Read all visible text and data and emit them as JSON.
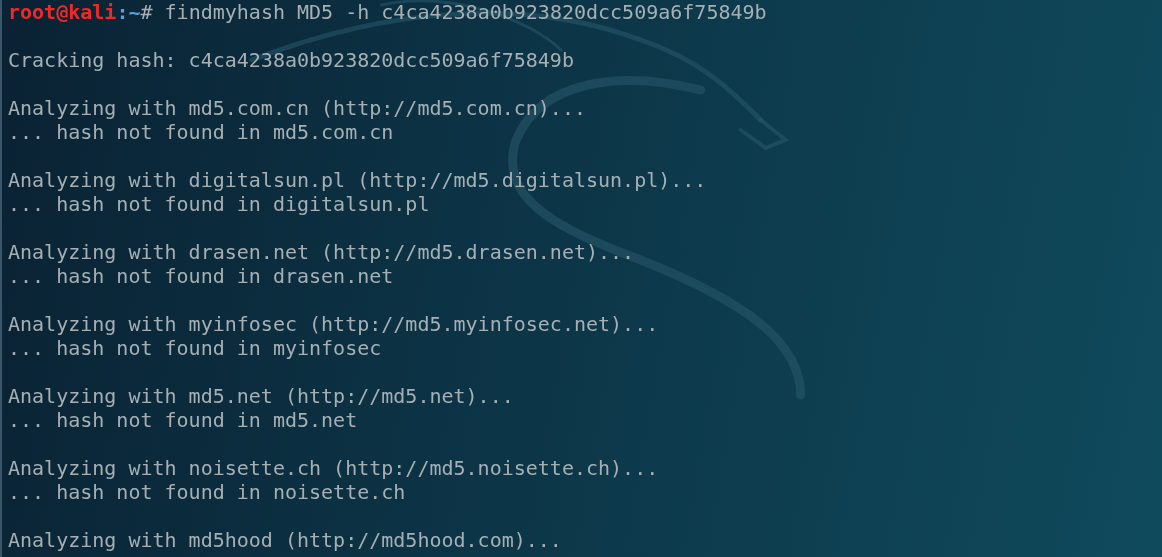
{
  "prompt": {
    "user_host": "root@kali",
    "path": ":~",
    "symbol": "#",
    "command": "findmyhash MD5 -h c4ca4238a0b923820dcc509a6f75849b"
  },
  "output_blocks": [
    {
      "lines": [
        "Cracking hash: c4ca4238a0b923820dcc509a6f75849b"
      ]
    },
    {
      "lines": [
        "Analyzing with md5.com.cn (http://md5.com.cn)...",
        "... hash not found in md5.com.cn"
      ]
    },
    {
      "lines": [
        "Analyzing with digitalsun.pl (http://md5.digitalsun.pl)...",
        "... hash not found in digitalsun.pl"
      ]
    },
    {
      "lines": [
        "Analyzing with drasen.net (http://md5.drasen.net)...",
        "... hash not found in drasen.net"
      ]
    },
    {
      "lines": [
        "Analyzing with myinfosec (http://md5.myinfosec.net)...",
        "... hash not found in myinfosec"
      ]
    },
    {
      "lines": [
        "Analyzing with md5.net (http://md5.net)...",
        "... hash not found in md5.net"
      ]
    },
    {
      "lines": [
        "Analyzing with noisette.ch (http://md5.noisette.ch)...",
        "... hash not found in noisette.ch"
      ]
    },
    {
      "lines": [
        "Analyzing with md5hood (http://md5hood.com)..."
      ]
    }
  ]
}
